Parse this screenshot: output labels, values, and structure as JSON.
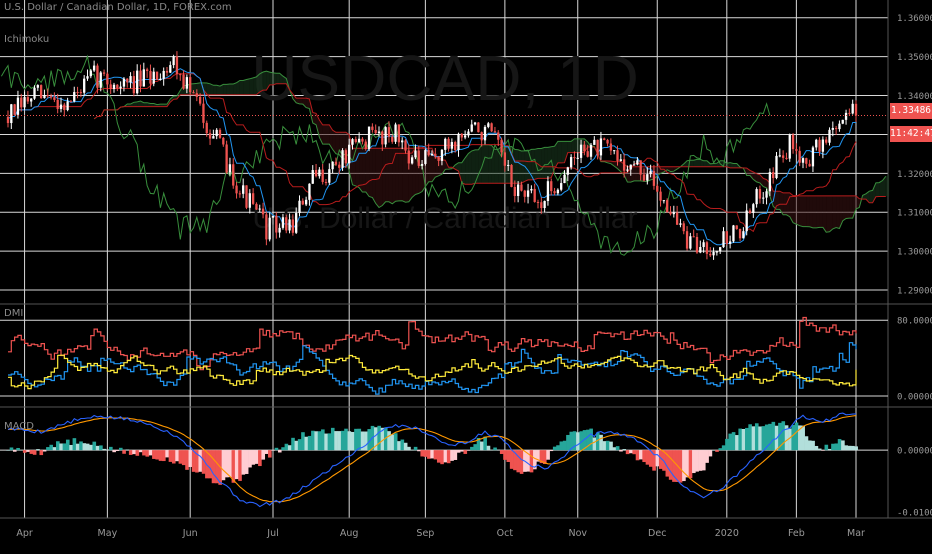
{
  "header": {
    "symbol_title": "U.S. Dollar / Canadian Dollar, 1D, FOREX.com",
    "indicator_1": "Ichimoku",
    "indicator_2": "DMI",
    "indicator_3": "MACD"
  },
  "watermark": {
    "ticker": "USDCAD, 1D",
    "name": "U.S. Dollar / Canadian Dollar"
  },
  "price_tags": {
    "last_price": "1.33486",
    "countdown": "11:42:47"
  },
  "colors": {
    "background": "#000000",
    "grid": "#d9d9d9",
    "candle_up": "#ffffff",
    "candle_down": "#ef5350",
    "tenkan": "#2196f3",
    "kijun": "#b71c1c",
    "chikou": "#388e3c",
    "span_a": "#388e3c",
    "span_b": "#b71c1c",
    "dmi_plus": "#2196f3",
    "dmi_minus": "#ef5350",
    "adx": "#ffeb3b",
    "macd_line": "#2962ff",
    "signal_line": "#ff9800",
    "hist_up": "#26a69a",
    "hist_down": "#ef5350"
  },
  "chart_data": [
    {
      "type": "candlestick",
      "panel": "price",
      "y_ticks": [
        "1.36000",
        "1.35000",
        "1.34000",
        "1.33000",
        "1.32000",
        "1.31000",
        "1.30000",
        "1.29000"
      ],
      "ylim": [
        1.2895,
        1.3625
      ],
      "months": [
        "Apr",
        "May",
        "Jun",
        "Jul",
        "Aug",
        "Sep",
        "Oct",
        "Nov",
        "Dec",
        "2020",
        "Feb",
        "Mar"
      ],
      "close_anchors": [
        [
          0,
          1.3345
        ],
        [
          8,
          1.34
        ],
        [
          18,
          1.338
        ],
        [
          26,
          1.345
        ],
        [
          34,
          1.3425
        ],
        [
          42,
          1.344
        ],
        [
          50,
          1.349
        ],
        [
          56,
          1.3395
        ],
        [
          62,
          1.33
        ],
        [
          70,
          1.316
        ],
        [
          78,
          1.306
        ],
        [
          86,
          1.307
        ],
        [
          92,
          1.318
        ],
        [
          100,
          1.323
        ],
        [
          108,
          1.329
        ],
        [
          116,
          1.331
        ],
        [
          124,
          1.322
        ],
        [
          130,
          1.325
        ],
        [
          140,
          1.3315
        ],
        [
          146,
          1.33
        ],
        [
          152,
          1.317
        ],
        [
          160,
          1.312
        ],
        [
          166,
          1.318
        ],
        [
          174,
          1.327
        ],
        [
          180,
          1.326
        ],
        [
          186,
          1.323
        ],
        [
          192,
          1.32
        ],
        [
          198,
          1.314
        ],
        [
          206,
          1.301
        ],
        [
          214,
          1.302
        ],
        [
          222,
          1.306
        ],
        [
          230,
          1.32
        ],
        [
          236,
          1.327
        ],
        [
          242,
          1.324
        ],
        [
          248,
          1.33
        ],
        [
          254,
          1.337
        ],
        [
          256,
          1.3349
        ]
      ],
      "last_price": 1.33486
    },
    {
      "type": "line",
      "panel": "DMI",
      "y_ticks": [
        "80.00000",
        "0.00000"
      ],
      "ylim": [
        0,
        95
      ],
      "series": []
    },
    {
      "type": "line",
      "panel": "MACD",
      "y_ticks": [
        "0.00000",
        "-0.01000"
      ],
      "ylim": [
        -0.0105,
        0.0065
      ],
      "macd_anchors": [
        [
          0,
          0.0035
        ],
        [
          10,
          0.003
        ],
        [
          20,
          0.0048
        ],
        [
          28,
          0.0055
        ],
        [
          36,
          0.005
        ],
        [
          44,
          0.004
        ],
        [
          52,
          0.002
        ],
        [
          58,
          -0.001
        ],
        [
          64,
          -0.005
        ],
        [
          70,
          -0.008
        ],
        [
          76,
          -0.009
        ],
        [
          84,
          -0.008
        ],
        [
          92,
          -0.005
        ],
        [
          100,
          -0.002
        ],
        [
          108,
          0.001
        ],
        [
          114,
          0.0038
        ],
        [
          120,
          0.004
        ],
        [
          126,
          0.003
        ],
        [
          132,
          0.001
        ],
        [
          138,
          0.001
        ],
        [
          144,
          0.003
        ],
        [
          150,
          0.0015
        ],
        [
          156,
          -0.002
        ],
        [
          162,
          -0.003
        ],
        [
          168,
          -0.001
        ],
        [
          174,
          0.002
        ],
        [
          180,
          0.003
        ],
        [
          186,
          0.0025
        ],
        [
          192,
          0.001
        ],
        [
          198,
          -0.002
        ],
        [
          204,
          -0.006
        ],
        [
          210,
          -0.0075
        ],
        [
          216,
          -0.006
        ],
        [
          222,
          -0.003
        ],
        [
          228,
          0.0
        ],
        [
          234,
          0.003
        ],
        [
          240,
          0.0055
        ],
        [
          246,
          0.0045
        ],
        [
          252,
          0.006
        ],
        [
          256,
          0.006
        ]
      ]
    }
  ]
}
